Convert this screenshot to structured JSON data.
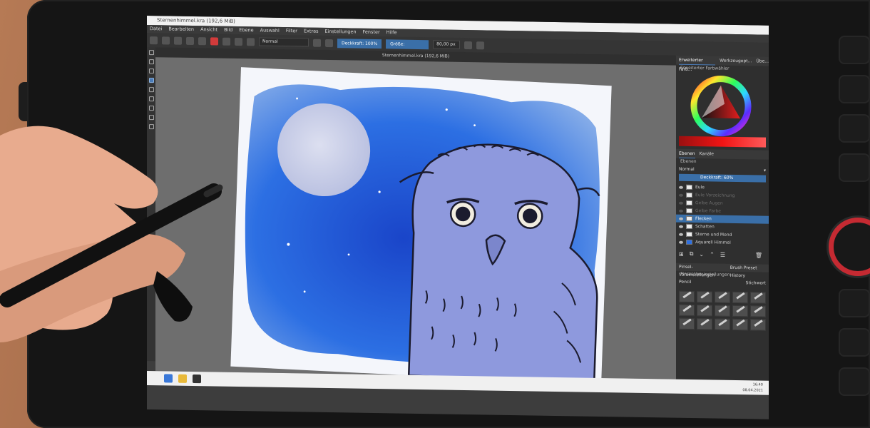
{
  "app": {
    "window_title": "Sternenhimmel.kra (192,6 MiB)",
    "menu": [
      "Datei",
      "Bearbeiten",
      "Ansicht",
      "Bild",
      "Ebene",
      "Auswahl",
      "Filter",
      "Extras",
      "Einstellungen",
      "Fenster",
      "Hilfe"
    ]
  },
  "toolbar": {
    "blend_mode": "Normal",
    "opacity_label": "Deckkraft:",
    "opacity_value": "100%",
    "size_label": "Größe:",
    "size_value": "80,00 px"
  },
  "document_tab": "Sternenhimmel.kra (192,6 MiB)",
  "right_panel": {
    "top_tabs": [
      "Erweiterter Farb...",
      "Werkzeugopt...",
      "Übe..."
    ],
    "color_selector_title": "Erweiterter Farbwähler",
    "layers_tabs": [
      "Ebenen",
      "Kanäle"
    ],
    "layers_header": "Ebenen",
    "blend_mode": "Normal",
    "opacity": "Deckkraft: 60%",
    "layers": [
      {
        "name": "Eule",
        "state": "visible"
      },
      {
        "name": "Eule Vorzeichnung",
        "state": "faded"
      },
      {
        "name": "Gelbe Augen",
        "state": "faded"
      },
      {
        "name": "Gelbe Farbe",
        "state": "faded"
      },
      {
        "name": "Flecken",
        "state": "selected"
      },
      {
        "name": "Schatten",
        "state": "visible"
      },
      {
        "name": "Sterne und Mond",
        "state": "visible"
      },
      {
        "name": "Aquarell Himmel",
        "state": "visible"
      }
    ],
    "brush_tabs": [
      "Pinsel-Voreinstellungen",
      "Brush Preset History"
    ],
    "brush_header": "Pinsel-Voreinstellungen",
    "brush_filter": "Stichwort",
    "brush_group": "Pencil"
  },
  "taskbar": {
    "time": "16:40",
    "date": "08.04.2021"
  },
  "colors": {
    "sky_blue": "#1f63dc",
    "moon": "#cfd3ea",
    "owl": "#8e99dd",
    "accent_dial": "#c52a32"
  }
}
